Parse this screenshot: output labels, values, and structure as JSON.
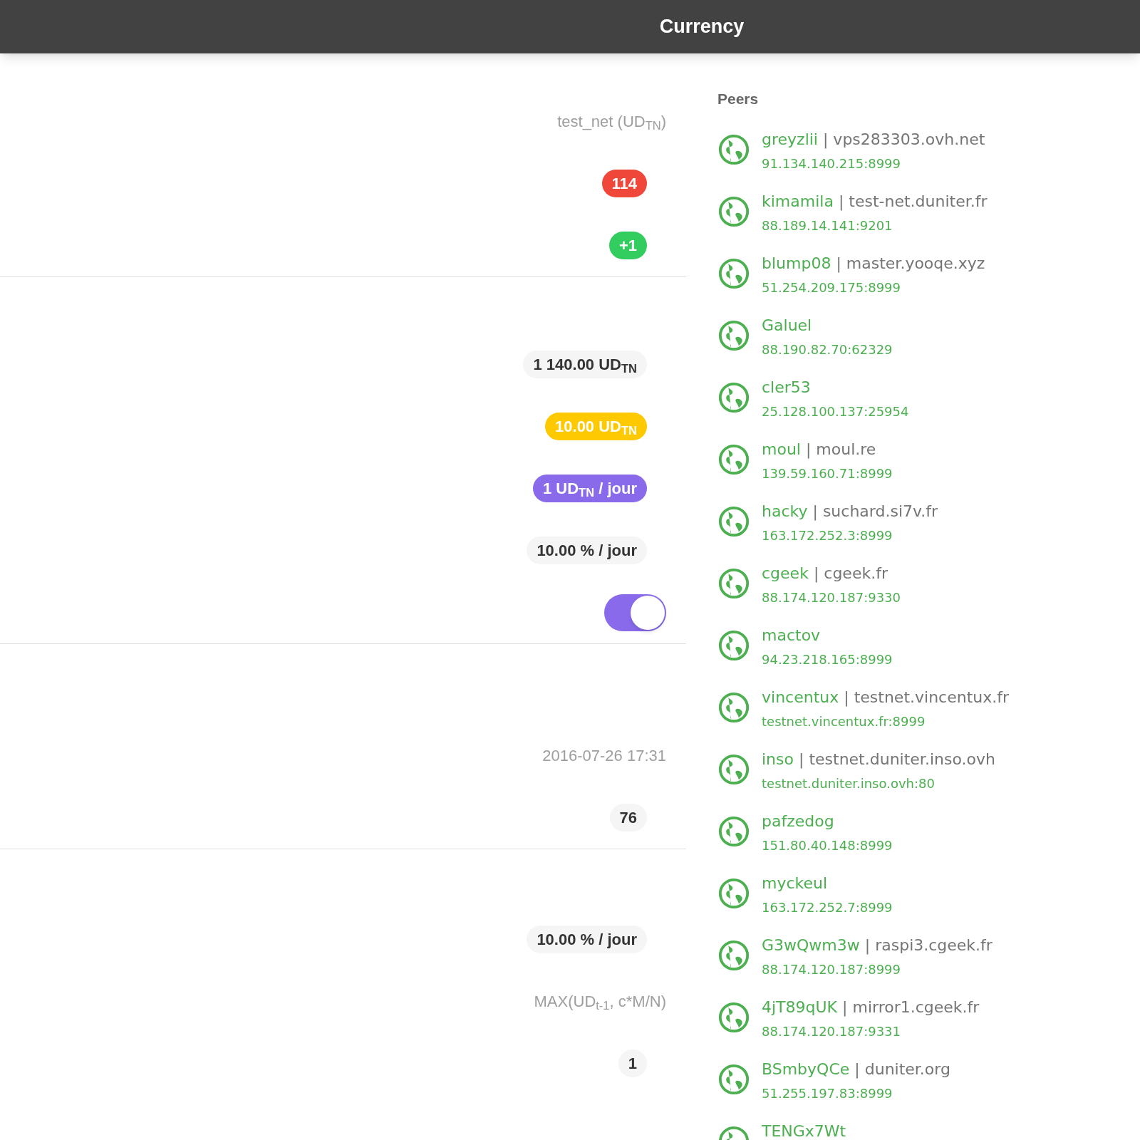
{
  "header": {
    "title": "Currency"
  },
  "sections": [
    {
      "rows": [
        {
          "kind": "text",
          "value": "test_net (UD$_{TN}$)"
        },
        {
          "kind": "badge",
          "value": "114",
          "color": "#ef473a"
        },
        {
          "kind": "badge",
          "value": "+1",
          "color": "#33cd5f"
        }
      ]
    },
    {
      "rows": [
        {
          "kind": "pill",
          "value": "1 140.00 UD$_{TN}$"
        },
        {
          "kind": "badge",
          "value": "10.00 UD$_{TN}$",
          "color": "#ffc900"
        },
        {
          "kind": "badge",
          "value": "1 UD$_{TN}$ / jour",
          "color": "#886aea"
        },
        {
          "kind": "pill",
          "value": "10.00 % / jour"
        },
        {
          "kind": "toggle",
          "on": true
        }
      ]
    },
    {
      "rows": [
        {
          "kind": "text",
          "value": "2016-07-26 17:31"
        },
        {
          "kind": "pill",
          "value": "76"
        }
      ]
    },
    {
      "rows": [
        {
          "kind": "pill",
          "value": "10.00 % / jour"
        },
        {
          "kind": "text",
          "value": "MAX(UD$_{t-1}$, c*M/N)"
        },
        {
          "kind": "pill",
          "value": "1"
        }
      ]
    }
  ],
  "peers": {
    "title": "Peers",
    "items": [
      {
        "name": "greyzlii",
        "host": "| vps283303.ovh.net",
        "address": "91.134.140.215:8999"
      },
      {
        "name": "kimamila",
        "host": "| test-net.duniter.fr",
        "address": "88.189.14.141:9201"
      },
      {
        "name": "blump08",
        "host": "| master.yooqe.xyz",
        "address": "51.254.209.175:8999"
      },
      {
        "name": "Galuel",
        "address": "88.190.82.70:62329"
      },
      {
        "name": "cler53",
        "address": "25.128.100.137:25954"
      },
      {
        "name": "moul",
        "host": "| moul.re",
        "address": "139.59.160.71:8999"
      },
      {
        "name": "hacky",
        "host": "| suchard.si7v.fr",
        "address": "163.172.252.3:8999"
      },
      {
        "name": "cgeek",
        "host": "| cgeek.fr",
        "address": "88.174.120.187:9330"
      },
      {
        "name": "mactov",
        "address": "94.23.218.165:8999"
      },
      {
        "name": "vincentux",
        "host": "| testnet.vincentux.fr",
        "address": "testnet.vincentux.fr:8999"
      },
      {
        "name": "inso",
        "host": "| testnet.duniter.inso.ovh",
        "address": "testnet.duniter.inso.ovh:80"
      },
      {
        "name": "pafzedog",
        "address": "151.80.40.148:8999"
      },
      {
        "name": "myckeul",
        "address": "163.172.252.7:8999"
      },
      {
        "name": "G3wQwm3w",
        "host": "| raspi3.cgeek.fr",
        "address": "88.174.120.187:8999"
      },
      {
        "name": "4jT89qUK",
        "host": "| mirror1.cgeek.fr",
        "address": "88.174.120.187:9331"
      },
      {
        "name": "BSmbyQCe",
        "host": "| duniter.org",
        "address": "51.255.197.83:8999"
      },
      {
        "name": "TENGx7Wt"
      }
    ]
  }
}
